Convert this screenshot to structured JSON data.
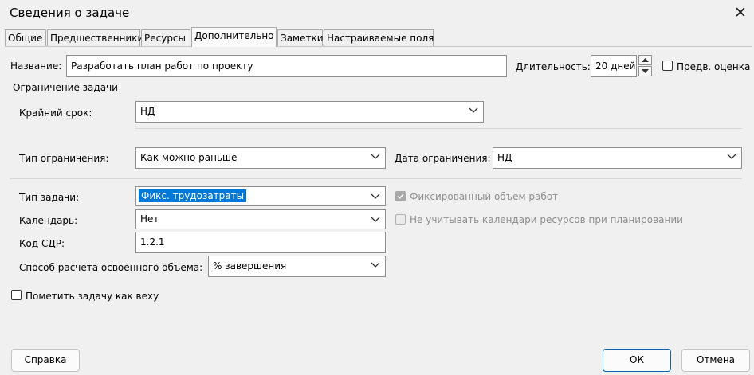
{
  "window": {
    "title": "Сведения о задаче"
  },
  "tabs": [
    {
      "label": "Общие"
    },
    {
      "label": "Предшественники"
    },
    {
      "label": "Ресурсы"
    },
    {
      "label": "Дополнительно"
    },
    {
      "label": "Заметки"
    },
    {
      "label": "Настраиваемые поля"
    }
  ],
  "active_tab": "Дополнительно",
  "name": {
    "label": "Название:",
    "value": "Разработать план работ по проекту"
  },
  "duration": {
    "label": "Длительность:",
    "value": "20 дней",
    "estimate_label": "Предв. оценка",
    "estimate_checked": false
  },
  "constraints": {
    "group_label": "Ограничение задачи",
    "deadline_label": "Крайний срок:",
    "deadline_value": "НД",
    "type_label": "Тип ограничения:",
    "type_value": "Как можно раньше",
    "date_label": "Дата ограничения:",
    "date_value": "НД"
  },
  "task": {
    "type_label": "Тип задачи:",
    "type_value": "Фикс. трудозатраты",
    "calendar_label": "Календарь:",
    "calendar_value": "Нет",
    "wbs_label": "Код СДР:",
    "wbs_value": "1.2.1",
    "ev_label": "Способ расчета освоенного объема:",
    "ev_value": "% завершения",
    "effort_driven_label": "Фиксированный объем работ",
    "effort_driven_checked": true,
    "ignore_resource_calendars_label": "Не учитывать календари ресурсов при планировании",
    "ignore_resource_calendars_checked": false,
    "milestone_label": "Пометить задачу как веху",
    "milestone_checked": false
  },
  "buttons": {
    "help": "Справка",
    "ok": "ОК",
    "cancel": "Отмена"
  },
  "colors": {
    "accent": "#0078d7",
    "primary_border": "#0067c0",
    "background": "#f0f0f0"
  }
}
